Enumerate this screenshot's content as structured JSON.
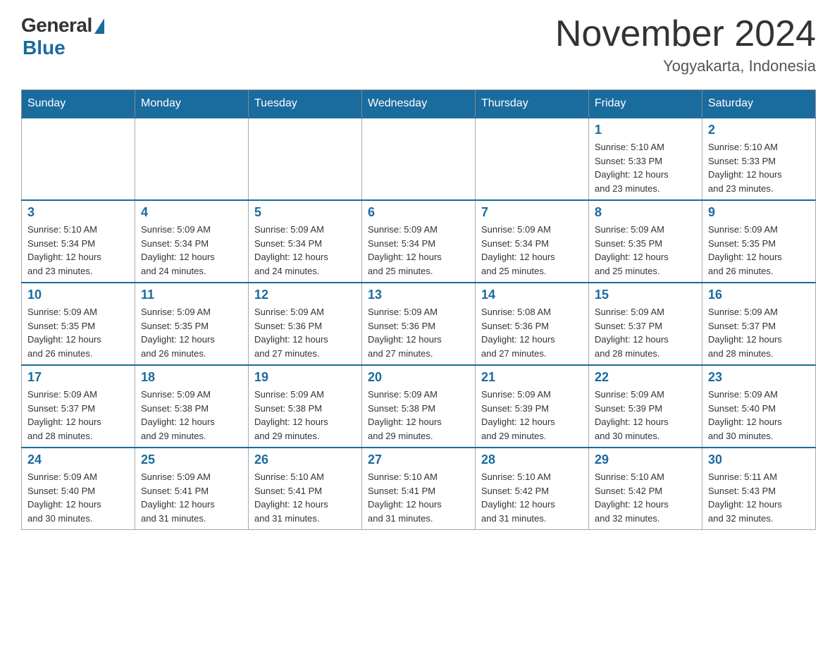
{
  "logo": {
    "general": "General",
    "blue": "Blue"
  },
  "title": "November 2024",
  "subtitle": "Yogyakarta, Indonesia",
  "days_of_week": [
    "Sunday",
    "Monday",
    "Tuesday",
    "Wednesday",
    "Thursday",
    "Friday",
    "Saturday"
  ],
  "weeks": [
    [
      {
        "day": "",
        "info": ""
      },
      {
        "day": "",
        "info": ""
      },
      {
        "day": "",
        "info": ""
      },
      {
        "day": "",
        "info": ""
      },
      {
        "day": "",
        "info": ""
      },
      {
        "day": "1",
        "info": "Sunrise: 5:10 AM\nSunset: 5:33 PM\nDaylight: 12 hours\nand 23 minutes."
      },
      {
        "day": "2",
        "info": "Sunrise: 5:10 AM\nSunset: 5:33 PM\nDaylight: 12 hours\nand 23 minutes."
      }
    ],
    [
      {
        "day": "3",
        "info": "Sunrise: 5:10 AM\nSunset: 5:34 PM\nDaylight: 12 hours\nand 23 minutes."
      },
      {
        "day": "4",
        "info": "Sunrise: 5:09 AM\nSunset: 5:34 PM\nDaylight: 12 hours\nand 24 minutes."
      },
      {
        "day": "5",
        "info": "Sunrise: 5:09 AM\nSunset: 5:34 PM\nDaylight: 12 hours\nand 24 minutes."
      },
      {
        "day": "6",
        "info": "Sunrise: 5:09 AM\nSunset: 5:34 PM\nDaylight: 12 hours\nand 25 minutes."
      },
      {
        "day": "7",
        "info": "Sunrise: 5:09 AM\nSunset: 5:34 PM\nDaylight: 12 hours\nand 25 minutes."
      },
      {
        "day": "8",
        "info": "Sunrise: 5:09 AM\nSunset: 5:35 PM\nDaylight: 12 hours\nand 25 minutes."
      },
      {
        "day": "9",
        "info": "Sunrise: 5:09 AM\nSunset: 5:35 PM\nDaylight: 12 hours\nand 26 minutes."
      }
    ],
    [
      {
        "day": "10",
        "info": "Sunrise: 5:09 AM\nSunset: 5:35 PM\nDaylight: 12 hours\nand 26 minutes."
      },
      {
        "day": "11",
        "info": "Sunrise: 5:09 AM\nSunset: 5:35 PM\nDaylight: 12 hours\nand 26 minutes."
      },
      {
        "day": "12",
        "info": "Sunrise: 5:09 AM\nSunset: 5:36 PM\nDaylight: 12 hours\nand 27 minutes."
      },
      {
        "day": "13",
        "info": "Sunrise: 5:09 AM\nSunset: 5:36 PM\nDaylight: 12 hours\nand 27 minutes."
      },
      {
        "day": "14",
        "info": "Sunrise: 5:08 AM\nSunset: 5:36 PM\nDaylight: 12 hours\nand 27 minutes."
      },
      {
        "day": "15",
        "info": "Sunrise: 5:09 AM\nSunset: 5:37 PM\nDaylight: 12 hours\nand 28 minutes."
      },
      {
        "day": "16",
        "info": "Sunrise: 5:09 AM\nSunset: 5:37 PM\nDaylight: 12 hours\nand 28 minutes."
      }
    ],
    [
      {
        "day": "17",
        "info": "Sunrise: 5:09 AM\nSunset: 5:37 PM\nDaylight: 12 hours\nand 28 minutes."
      },
      {
        "day": "18",
        "info": "Sunrise: 5:09 AM\nSunset: 5:38 PM\nDaylight: 12 hours\nand 29 minutes."
      },
      {
        "day": "19",
        "info": "Sunrise: 5:09 AM\nSunset: 5:38 PM\nDaylight: 12 hours\nand 29 minutes."
      },
      {
        "day": "20",
        "info": "Sunrise: 5:09 AM\nSunset: 5:38 PM\nDaylight: 12 hours\nand 29 minutes."
      },
      {
        "day": "21",
        "info": "Sunrise: 5:09 AM\nSunset: 5:39 PM\nDaylight: 12 hours\nand 29 minutes."
      },
      {
        "day": "22",
        "info": "Sunrise: 5:09 AM\nSunset: 5:39 PM\nDaylight: 12 hours\nand 30 minutes."
      },
      {
        "day": "23",
        "info": "Sunrise: 5:09 AM\nSunset: 5:40 PM\nDaylight: 12 hours\nand 30 minutes."
      }
    ],
    [
      {
        "day": "24",
        "info": "Sunrise: 5:09 AM\nSunset: 5:40 PM\nDaylight: 12 hours\nand 30 minutes."
      },
      {
        "day": "25",
        "info": "Sunrise: 5:09 AM\nSunset: 5:41 PM\nDaylight: 12 hours\nand 31 minutes."
      },
      {
        "day": "26",
        "info": "Sunrise: 5:10 AM\nSunset: 5:41 PM\nDaylight: 12 hours\nand 31 minutes."
      },
      {
        "day": "27",
        "info": "Sunrise: 5:10 AM\nSunset: 5:41 PM\nDaylight: 12 hours\nand 31 minutes."
      },
      {
        "day": "28",
        "info": "Sunrise: 5:10 AM\nSunset: 5:42 PM\nDaylight: 12 hours\nand 31 minutes."
      },
      {
        "day": "29",
        "info": "Sunrise: 5:10 AM\nSunset: 5:42 PM\nDaylight: 12 hours\nand 32 minutes."
      },
      {
        "day": "30",
        "info": "Sunrise: 5:11 AM\nSunset: 5:43 PM\nDaylight: 12 hours\nand 32 minutes."
      }
    ]
  ]
}
